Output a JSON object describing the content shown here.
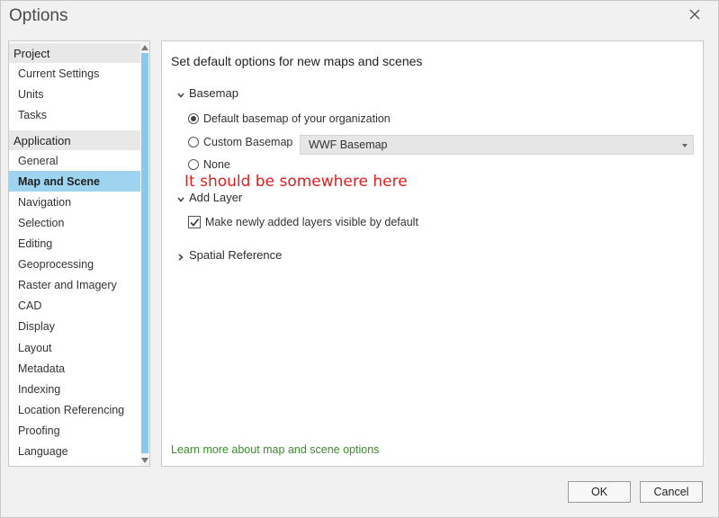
{
  "window": {
    "title": "Options"
  },
  "nav": {
    "categories": [
      {
        "label": "Project",
        "items": [
          "Current Settings",
          "Units",
          "Tasks"
        ]
      },
      {
        "label": "Application",
        "items": [
          "General",
          "Map and Scene",
          "Navigation",
          "Selection",
          "Editing",
          "Geoprocessing",
          "Raster and Imagery",
          "CAD",
          "Display",
          "Layout",
          "Metadata",
          "Indexing",
          "Location Referencing",
          "Proofing",
          "Language"
        ]
      }
    ],
    "selected": "Map and Scene"
  },
  "content": {
    "title": "Set default options for new maps and scenes",
    "basemap": {
      "heading": "Basemap",
      "options": {
        "default": "Default basemap of your organization",
        "custom": "Custom Basemap",
        "none": "None"
      },
      "selected": "default",
      "custom_value": "WWF Basemap"
    },
    "annotation": "It should be somewhere here",
    "add_layer": {
      "heading": "Add Layer",
      "checkbox_label": "Make newly added layers visible by default",
      "checked": true
    },
    "spatial_reference": {
      "heading": "Spatial Reference"
    },
    "learn_more": "Learn more about map and scene options"
  },
  "buttons": {
    "ok": "OK",
    "cancel": "Cancel"
  },
  "colors": {
    "selection": "#9fd4f0",
    "link": "#3c8c2c",
    "annotation": "#e02020"
  }
}
